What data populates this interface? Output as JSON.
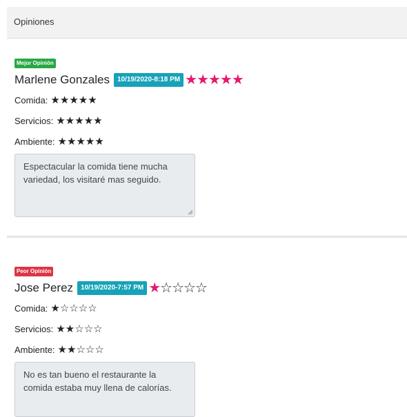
{
  "panel": {
    "title": "Opiniones"
  },
  "reviews": [
    {
      "badge": "Mejor Opinión",
      "name": "Marlene Gonzales",
      "date": "10/19/2020-8:18 PM",
      "rating": "★★★★★",
      "categories": [
        {
          "label": "Comida:",
          "stars": "★★★★★"
        },
        {
          "label": "Servicios:",
          "stars": "★★★★★"
        },
        {
          "label": "Ambiente:",
          "stars": "★★★★★"
        }
      ],
      "comment": "Espectacular la comida tiene mucha variedad, los visitaré mas seguido."
    },
    {
      "badge": "Peor Opinión",
      "name": "Jose Perez",
      "date": "10/19/2020-7:57 PM",
      "rating_on": "★",
      "rating_off": "☆☆☆☆",
      "categories": [
        {
          "label": "Comida:",
          "stars": "★☆☆☆☆"
        },
        {
          "label": "Servicios:",
          "stars": "★★☆☆☆"
        },
        {
          "label": "Ambiente:",
          "stars": "★★☆☆☆"
        }
      ],
      "comment": "No es tan bueno el restaurante la comida estaba muy llena de calorías."
    }
  ],
  "colors": {
    "best": "#28a745",
    "worst": "#dc3545",
    "date": "#17a2b8",
    "star_pink": "#e6196b"
  }
}
